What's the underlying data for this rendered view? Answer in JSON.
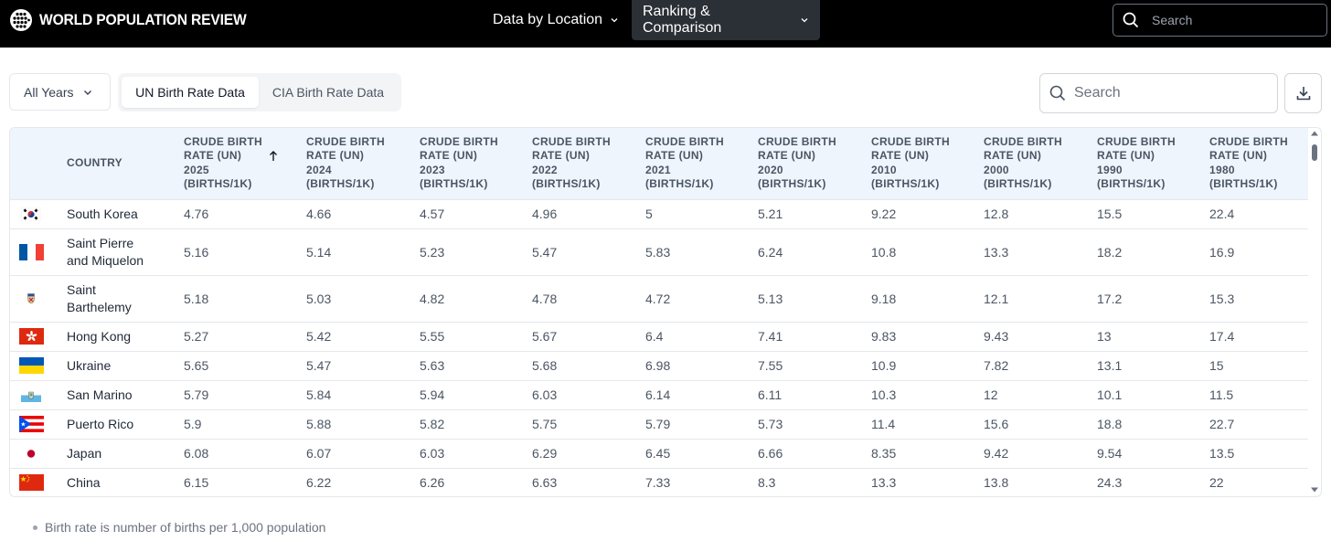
{
  "brand": {
    "name": "WORLD POPULATION REVIEW"
  },
  "nav": {
    "items": [
      {
        "label": "Data by Location"
      },
      {
        "label": "Ranking & Comparison"
      }
    ],
    "search_placeholder": "Search"
  },
  "controls": {
    "years_select": "All Years",
    "tabs": [
      {
        "label": "UN Birth Rate Data",
        "active": true
      },
      {
        "label": "CIA Birth Rate Data",
        "active": false
      }
    ],
    "search_placeholder": "Search"
  },
  "table": {
    "country_header": "COUNTRY",
    "columns": [
      {
        "line1": "CRUDE BIRTH",
        "line2": "RATE (UN)",
        "year": "2025",
        "unit": "(BIRTHS/1K)",
        "sorted": "asc"
      },
      {
        "line1": "CRUDE BIRTH",
        "line2": "RATE (UN)",
        "year": "2024",
        "unit": "(BIRTHS/1K)"
      },
      {
        "line1": "CRUDE BIRTH",
        "line2": "RATE (UN)",
        "year": "2023",
        "unit": "(BIRTHS/1K)"
      },
      {
        "line1": "CRUDE BIRTH",
        "line2": "RATE (UN)",
        "year": "2022",
        "unit": "(BIRTHS/1K)"
      },
      {
        "line1": "CRUDE BIRTH",
        "line2": "RATE (UN)",
        "year": "2021",
        "unit": "(BIRTHS/1K)"
      },
      {
        "line1": "CRUDE BIRTH",
        "line2": "RATE (UN)",
        "year": "2020",
        "unit": "(BIRTHS/1K)"
      },
      {
        "line1": "CRUDE BIRTH",
        "line2": "RATE (UN)",
        "year": "2010",
        "unit": "(BIRTHS/1K)"
      },
      {
        "line1": "CRUDE BIRTH",
        "line2": "RATE (UN)",
        "year": "2000",
        "unit": "(BIRTHS/1K)"
      },
      {
        "line1": "CRUDE BIRTH",
        "line2": "RATE (UN)",
        "year": "1990",
        "unit": "(BIRTHS/1K)"
      },
      {
        "line1": "CRUDE BIRTH",
        "line2": "RATE (UN)",
        "year": "1980",
        "unit": "(BIRTHS/1K)"
      }
    ],
    "rows": [
      {
        "flag": "south-korea-flag",
        "name1": "South Korea",
        "name2": "",
        "values": [
          "4.76",
          "4.66",
          "4.57",
          "4.96",
          "5",
          "5.21",
          "9.22",
          "12.8",
          "15.5",
          "22.4"
        ]
      },
      {
        "flag": "france-flag",
        "name1": "Saint Pierre",
        "name2": "and Miquelon",
        "values": [
          "5.16",
          "5.14",
          "5.23",
          "5.47",
          "5.83",
          "6.24",
          "10.8",
          "13.3",
          "18.2",
          "16.9"
        ]
      },
      {
        "flag": "saint-barthelemy-flag",
        "name1": "Saint",
        "name2": "Barthelemy",
        "values": [
          "5.18",
          "5.03",
          "4.82",
          "4.78",
          "4.72",
          "5.13",
          "9.18",
          "12.1",
          "17.2",
          "15.3"
        ]
      },
      {
        "flag": "hong-kong-flag",
        "name1": "Hong Kong",
        "name2": "",
        "values": [
          "5.27",
          "5.42",
          "5.55",
          "5.67",
          "6.4",
          "7.41",
          "9.83",
          "9.43",
          "13",
          "17.4"
        ]
      },
      {
        "flag": "ukraine-flag",
        "name1": "Ukraine",
        "name2": "",
        "values": [
          "5.65",
          "5.47",
          "5.63",
          "5.68",
          "6.98",
          "7.55",
          "10.9",
          "7.82",
          "13.1",
          "15"
        ]
      },
      {
        "flag": "san-marino-flag",
        "name1": "San Marino",
        "name2": "",
        "values": [
          "5.79",
          "5.84",
          "5.94",
          "6.03",
          "6.14",
          "6.11",
          "10.3",
          "12",
          "10.1",
          "11.5"
        ]
      },
      {
        "flag": "puerto-rico-flag",
        "name1": "Puerto Rico",
        "name2": "",
        "values": [
          "5.9",
          "5.88",
          "5.82",
          "5.75",
          "5.79",
          "5.73",
          "11.4",
          "15.6",
          "18.8",
          "22.7"
        ]
      },
      {
        "flag": "japan-flag",
        "name1": "Japan",
        "name2": "",
        "values": [
          "6.08",
          "6.07",
          "6.03",
          "6.29",
          "6.45",
          "6.66",
          "8.35",
          "9.42",
          "9.54",
          "13.5"
        ]
      },
      {
        "flag": "china-flag",
        "name1": "China",
        "name2": "",
        "values": [
          "6.15",
          "6.22",
          "6.26",
          "6.63",
          "7.33",
          "8.3",
          "13.3",
          "13.8",
          "24.3",
          "22"
        ]
      }
    ]
  },
  "footnote": "Birth rate is number of births per 1,000 population",
  "colors": {
    "topbar": "#000000",
    "active_nav": "#2b2f36",
    "table_header": "#eef5fc",
    "border": "#e5e7eb"
  }
}
